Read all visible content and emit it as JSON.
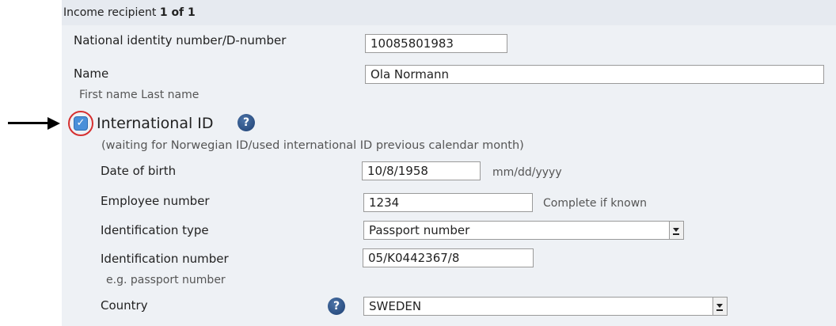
{
  "header": {
    "prefix": "Income recipient",
    "counter": "1 of 1"
  },
  "fields": {
    "nin": {
      "label": "National identity number/D-number",
      "value": "10085801983"
    },
    "name": {
      "label": "Name",
      "value": "Ola Normann",
      "hint": "First name Last name"
    },
    "international": {
      "label": "International ID",
      "checked": true,
      "note": "(waiting for Norwegian ID/used international ID previous calendar month)"
    },
    "dob": {
      "label": "Date of birth",
      "value": "10/8/1958",
      "hint": "mm/dd/yyyy"
    },
    "employee": {
      "label": "Employee number",
      "value": "1234",
      "hint": "Complete if known"
    },
    "id_type": {
      "label": "Identification type",
      "value": "Passport number"
    },
    "id_number": {
      "label": "Identification number",
      "value": "05/K0442367/8",
      "hint": "e.g. passport number"
    },
    "country": {
      "label": "Country",
      "value": "SWEDEN"
    }
  },
  "icons": {
    "help": "?",
    "check": "✓"
  },
  "colors": {
    "panel_bg": "#eef1f5",
    "highlight_ring": "#d63030",
    "help_icon": "#2a5089"
  }
}
